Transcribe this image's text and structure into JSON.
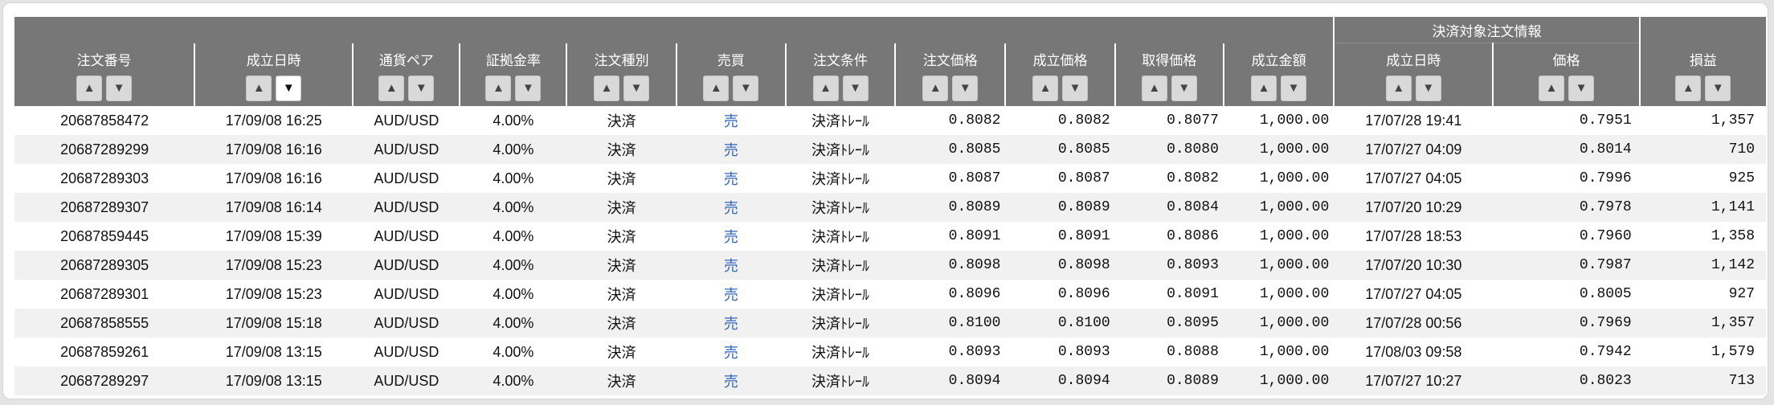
{
  "header": {
    "group_label": "決済対象注文情報",
    "columns": [
      "注文番号",
      "成立日時",
      "通貨ペア",
      "証拠金率",
      "注文種別",
      "売買",
      "注文条件",
      "注文価格",
      "成立価格",
      "取得価格",
      "成立金額"
    ],
    "settle_columns": [
      "成立日時",
      "価格"
    ],
    "pl_label": "損益",
    "sort_asc_icon": "▲",
    "sort_desc_icon": "▼"
  },
  "rows": [
    {
      "order_no": "20687858472",
      "exec_time": "17/09/08 16:25",
      "pair": "AUD/USD",
      "margin": "4.00%",
      "type": "決済",
      "side": "売",
      "condition": "決済ﾄﾚｰﾙ",
      "order_price": "0.8082",
      "exec_price": "0.8082",
      "acq_price": "0.8077",
      "amount": "1,000.00",
      "settle_time": "17/07/28 19:41",
      "settle_price": "0.7951",
      "pl": "1,357"
    },
    {
      "order_no": "20687289299",
      "exec_time": "17/09/08 16:16",
      "pair": "AUD/USD",
      "margin": "4.00%",
      "type": "決済",
      "side": "売",
      "condition": "決済ﾄﾚｰﾙ",
      "order_price": "0.8085",
      "exec_price": "0.8085",
      "acq_price": "0.8080",
      "amount": "1,000.00",
      "settle_time": "17/07/27 04:09",
      "settle_price": "0.8014",
      "pl": "710"
    },
    {
      "order_no": "20687289303",
      "exec_time": "17/09/08 16:16",
      "pair": "AUD/USD",
      "margin": "4.00%",
      "type": "決済",
      "side": "売",
      "condition": "決済ﾄﾚｰﾙ",
      "order_price": "0.8087",
      "exec_price": "0.8087",
      "acq_price": "0.8082",
      "amount": "1,000.00",
      "settle_time": "17/07/27 04:05",
      "settle_price": "0.7996",
      "pl": "925"
    },
    {
      "order_no": "20687289307",
      "exec_time": "17/09/08 16:14",
      "pair": "AUD/USD",
      "margin": "4.00%",
      "type": "決済",
      "side": "売",
      "condition": "決済ﾄﾚｰﾙ",
      "order_price": "0.8089",
      "exec_price": "0.8089",
      "acq_price": "0.8084",
      "amount": "1,000.00",
      "settle_time": "17/07/20 10:29",
      "settle_price": "0.7978",
      "pl": "1,141"
    },
    {
      "order_no": "20687859445",
      "exec_time": "17/09/08 15:39",
      "pair": "AUD/USD",
      "margin": "4.00%",
      "type": "決済",
      "side": "売",
      "condition": "決済ﾄﾚｰﾙ",
      "order_price": "0.8091",
      "exec_price": "0.8091",
      "acq_price": "0.8086",
      "amount": "1,000.00",
      "settle_time": "17/07/28 18:53",
      "settle_price": "0.7960",
      "pl": "1,358"
    },
    {
      "order_no": "20687289305",
      "exec_time": "17/09/08 15:23",
      "pair": "AUD/USD",
      "margin": "4.00%",
      "type": "決済",
      "side": "売",
      "condition": "決済ﾄﾚｰﾙ",
      "order_price": "0.8098",
      "exec_price": "0.8098",
      "acq_price": "0.8093",
      "amount": "1,000.00",
      "settle_time": "17/07/20 10:30",
      "settle_price": "0.7987",
      "pl": "1,142"
    },
    {
      "order_no": "20687289301",
      "exec_time": "17/09/08 15:23",
      "pair": "AUD/USD",
      "margin": "4.00%",
      "type": "決済",
      "side": "売",
      "condition": "決済ﾄﾚｰﾙ",
      "order_price": "0.8096",
      "exec_price": "0.8096",
      "acq_price": "0.8091",
      "amount": "1,000.00",
      "settle_time": "17/07/27 04:05",
      "settle_price": "0.8005",
      "pl": "927"
    },
    {
      "order_no": "20687858555",
      "exec_time": "17/09/08 15:18",
      "pair": "AUD/USD",
      "margin": "4.00%",
      "type": "決済",
      "side": "売",
      "condition": "決済ﾄﾚｰﾙ",
      "order_price": "0.8100",
      "exec_price": "0.8100",
      "acq_price": "0.8095",
      "amount": "1,000.00",
      "settle_time": "17/07/28 00:56",
      "settle_price": "0.7969",
      "pl": "1,357"
    },
    {
      "order_no": "20687859261",
      "exec_time": "17/09/08 13:15",
      "pair": "AUD/USD",
      "margin": "4.00%",
      "type": "決済",
      "side": "売",
      "condition": "決済ﾄﾚｰﾙ",
      "order_price": "0.8093",
      "exec_price": "0.8093",
      "acq_price": "0.8088",
      "amount": "1,000.00",
      "settle_time": "17/08/03 09:58",
      "settle_price": "0.7942",
      "pl": "1,579"
    },
    {
      "order_no": "20687289297",
      "exec_time": "17/09/08 13:15",
      "pair": "AUD/USD",
      "margin": "4.00%",
      "type": "決済",
      "side": "売",
      "condition": "決済ﾄﾚｰﾙ",
      "order_price": "0.8094",
      "exec_price": "0.8094",
      "acq_price": "0.8089",
      "amount": "1,000.00",
      "settle_time": "17/07/27 10:27",
      "settle_price": "0.8023",
      "pl": "713"
    }
  ],
  "colors": {
    "header_bg": "#777777",
    "side_sell": "#2f66b8",
    "row_alt": "#f1f1f1"
  }
}
